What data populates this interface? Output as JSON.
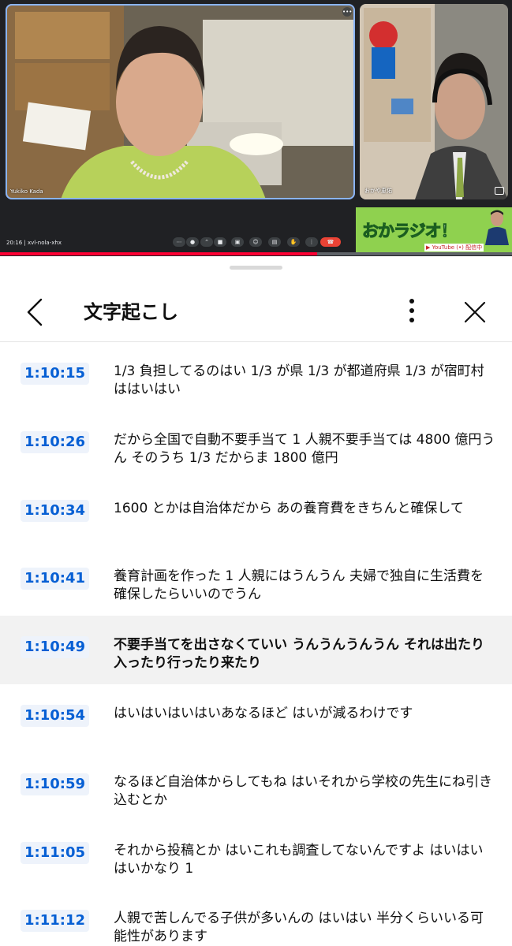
{
  "meet": {
    "participant_main": "Yukiko Kada",
    "participant_side": "おかや恵佑",
    "time": "20:16",
    "meeting_code": "xvl-nola-xhx",
    "more_icon": "more-vert-icon",
    "controls": [
      "more-horiz-icon",
      "mic-icon",
      "chevron-up-icon",
      "camera-icon",
      "present-icon",
      "emoji-icon",
      "captions-icon",
      "raise-hand-icon",
      "more-vert-icon",
      "call-end-icon"
    ]
  },
  "banner": {
    "title": "おかラジオ！",
    "subtitle": "▶ YouTube (•) 配信中"
  },
  "player": {
    "progress": 0.62,
    "progress_color": "#ff0033"
  },
  "sheet": {
    "title": "文字起こし",
    "back_icon": "chevron-left-icon",
    "menu_icon": "more-vert-icon",
    "close_icon": "close-icon"
  },
  "transcript": [
    {
      "time": "1:10:15",
      "text": "1/3 負担してるのはい 1/3 が県 1/3 が都道府県 1/3 が宿町村ははいはい"
    },
    {
      "time": "1:10:26",
      "text": "だから全国で自動不要手当て 1 人親不要手当ては 4800 億円うん そのうち 1/3 だからま 1800 億円"
    },
    {
      "time": "1:10:34",
      "text": "1600 とかは自治体だから あの養育費をきちんと確保して"
    },
    {
      "time": "1:10:41",
      "text": "養育計画を作った 1 人親にはうんうん 夫婦で独自に生活費を確保したらいいのでうん"
    },
    {
      "time": "1:10:49",
      "text": "不要手当てを出さなくていい うんうんうんうん それは出たり入ったり行ったり来たり",
      "active": true
    },
    {
      "time": "1:10:54",
      "text": "はいはいはいはいあなるほど はいが減るわけです"
    },
    {
      "time": "1:10:59",
      "text": "なるほど自治体からしてもね はいそれから学校の先生にね引き込むとか"
    },
    {
      "time": "1:11:05",
      "text": "それから投稿とか はいこれも調査してないんですよ はいはいはいかなり 1"
    },
    {
      "time": "1:11:12",
      "text": "人親で苦しんでる子供が多いんの はいはい 半分くらいいる可能性があります"
    }
  ],
  "colors": {
    "timestamp": "#065fd4",
    "active_row": "#f2f2f2",
    "meet_bg": "#202124",
    "banner_green": "#8fd14f"
  }
}
